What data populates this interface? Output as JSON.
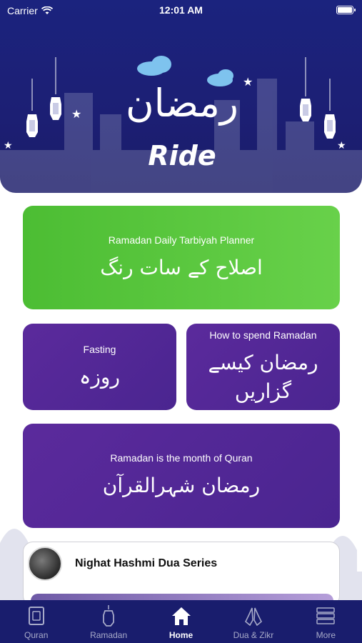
{
  "status_bar": {
    "carrier": "Carrier",
    "time": "12:01 AM"
  },
  "header": {
    "logo_urdu": "رمضان",
    "logo_english": "Ride"
  },
  "cards": {
    "planner": {
      "title": "Ramadan Daily Tarbiyah Planner",
      "urdu": "اصلاح کے سات رنگ"
    },
    "fasting": {
      "title": "Fasting",
      "urdu": "روزہ"
    },
    "spend": {
      "title": "How to spend Ramadan",
      "urdu": "رمضان کیسے گزاریں"
    },
    "quran": {
      "title": "Ramadan is the month of Quran",
      "urdu": "رمضان شہرالقرآن"
    }
  },
  "dua_series": {
    "title": "Nighat Hashmi Dua Series"
  },
  "tabs": [
    {
      "label": "Quran",
      "icon": "quran-book-icon"
    },
    {
      "label": "Ramadan",
      "icon": "lantern-icon"
    },
    {
      "label": "Home",
      "icon": "home-icon"
    },
    {
      "label": "Dua & Zikr",
      "icon": "praying-hands-icon"
    },
    {
      "label": "More",
      "icon": "more-list-icon"
    }
  ],
  "colors": {
    "header_bg": "#1b237e",
    "green_card": "#4cbd33",
    "purple_card": "#5b2a9c",
    "tabbar_bg": "#191d6d"
  }
}
